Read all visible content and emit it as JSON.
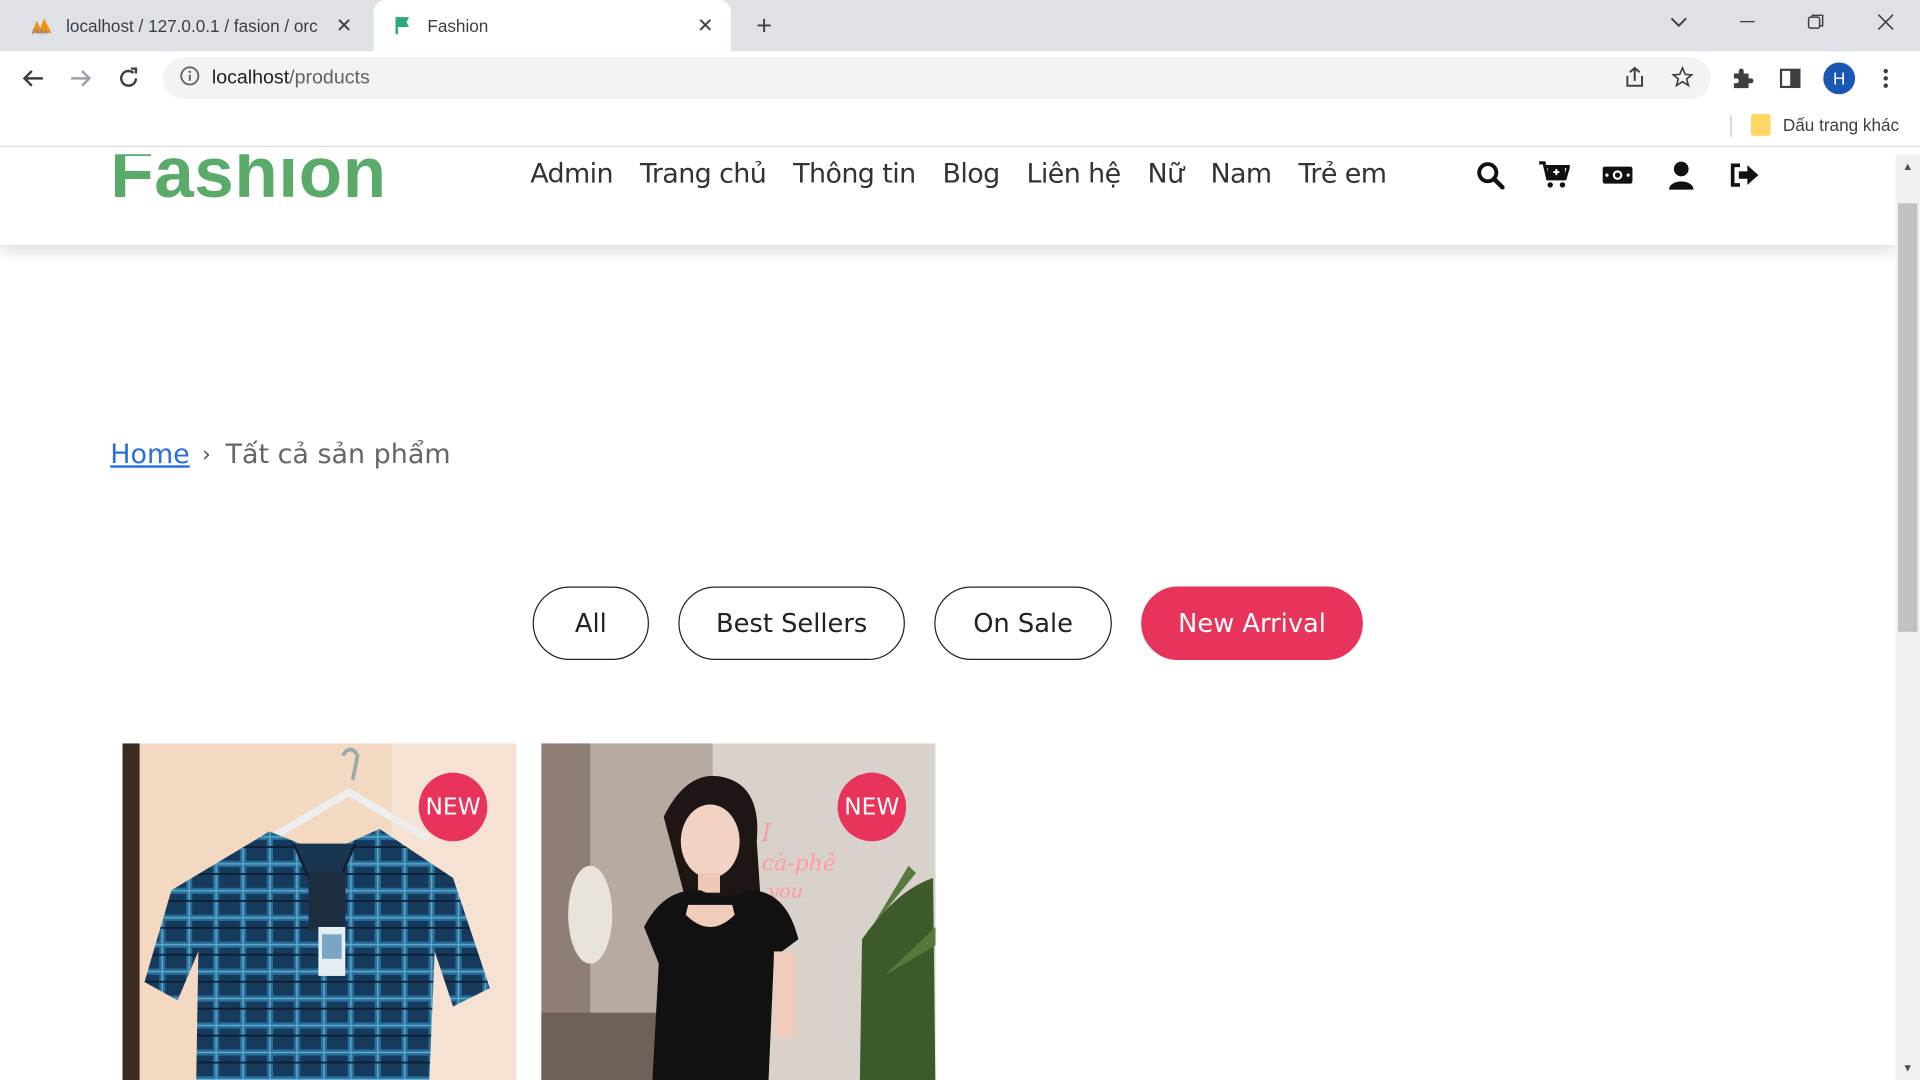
{
  "browser": {
    "tabs": [
      {
        "title": "localhost / 127.0.0.1 / fasion / orc",
        "active": false,
        "favicon": "phpmyadmin-icon"
      },
      {
        "title": "Fashion",
        "active": true,
        "favicon": "flag-icon"
      }
    ],
    "address": {
      "host": "localhost",
      "path": "/products"
    },
    "avatar_letter": "H",
    "bookmark_folder": "Dấu trang khác"
  },
  "site": {
    "logo": "Fashion",
    "nav": [
      "Admin",
      "Trang chủ",
      "Thông tin",
      "Blog",
      "Liên hệ",
      "Nữ",
      "Nam",
      "Trẻ em"
    ],
    "header_icons": [
      "search-icon",
      "cart-icon",
      "money-icon",
      "user-icon",
      "logout-icon"
    ],
    "breadcrumb": {
      "home": "Home",
      "current": "Tất cả sản phẩm"
    },
    "filters": [
      {
        "label": "All",
        "active": false
      },
      {
        "label": "Best Sellers",
        "active": false
      },
      {
        "label": "On Sale",
        "active": false
      },
      {
        "label": "New Arrival",
        "active": true
      }
    ],
    "products": [
      {
        "badge": "NEW",
        "image": "plaid-shirt-on-hanger"
      },
      {
        "badge": "NEW",
        "image": "woman-in-black-dress"
      }
    ],
    "accent_color": "#e8335a",
    "logo_color": "#5aab6a"
  }
}
